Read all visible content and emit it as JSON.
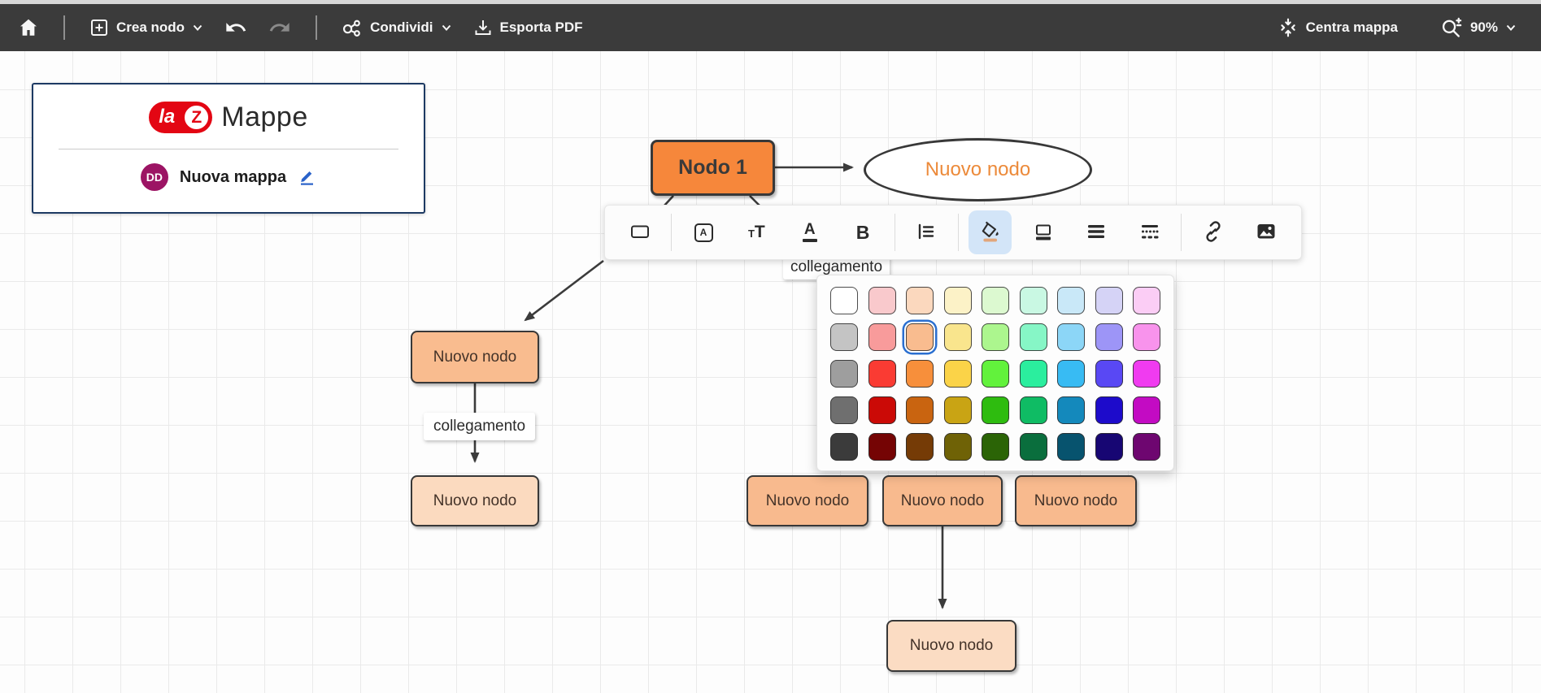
{
  "topbar": {
    "buttons": {
      "crea_nodo": "Crea nodo",
      "condividi": "Condividi",
      "esporta_pdf": "Esporta PDF",
      "centra_mappa": "Centra mappa"
    },
    "zoom_level": "90%"
  },
  "map_card": {
    "logo": {
      "la": "la",
      "z": "Z",
      "name": "Mappe"
    },
    "owner_initials": "DD",
    "title": "Nuova mappa"
  },
  "canvas": {
    "nodes": [
      {
        "id": "root",
        "label": "Nodo 1",
        "fill": "#F6873B"
      },
      {
        "id": "ellipse",
        "label": "Nuovo nodo",
        "fill": "#FFFFFF"
      },
      {
        "id": "left-top",
        "label": "Nuovo nodo",
        "fill": "#F9BC8F"
      },
      {
        "id": "left-bottom",
        "label": "Nuovo nodo",
        "fill": "#FBDABF"
      },
      {
        "id": "mid-a",
        "label": "Nuovo nodo",
        "fill": "#F8BA8E"
      },
      {
        "id": "mid-b",
        "label": "Nuovo nodo",
        "fill": "#F8BA8E"
      },
      {
        "id": "mid-c",
        "label": "Nuovo nodo",
        "fill": "#F8BA8E"
      },
      {
        "id": "bottom",
        "label": "Nuovo nodo",
        "fill": "#FBDCC3"
      }
    ],
    "edge_label": "collegamento",
    "edge_label_partial": "collegamento"
  },
  "format_toolbar": {
    "tools": [
      "shape",
      "text-background",
      "font-size",
      "text-color",
      "bold",
      "align",
      "fill-color",
      "border-color",
      "border-width",
      "border-style",
      "link",
      "image"
    ],
    "active_tool": "fill-color"
  },
  "palette": {
    "selected": {
      "row": 1,
      "col": 2
    },
    "rows": [
      [
        "#FFFFFF",
        "#F9C9CC",
        "#FBD8BE",
        "#FCF2C7",
        "#DCF9D0",
        "#C9F8E3",
        "#C9E8F8",
        "#D5D3F6",
        "#FBCDF5"
      ],
      [
        "#C4C4C4",
        "#F89B9B",
        "#F9BC8F",
        "#F9E58D",
        "#ACF68E",
        "#86F6C6",
        "#8CD6F7",
        "#9D95F7",
        "#F893EC"
      ],
      [
        "#9E9E9E",
        "#FA3B33",
        "#F78F3B",
        "#FBD348",
        "#62F23C",
        "#2BEE9E",
        "#38BBF3",
        "#5948F4",
        "#F03BF0"
      ],
      [
        "#6F6F6F",
        "#CB0A06",
        "#C96410",
        "#C9A414",
        "#2EBC0F",
        "#0FBC64",
        "#1489BC",
        "#1D0BCB",
        "#C30BC3"
      ],
      [
        "#3B3B3B",
        "#750404",
        "#753B06",
        "#6F6206",
        "#2B6406",
        "#0A6E3D",
        "#07536E",
        "#170673",
        "#6E0670"
      ]
    ]
  },
  "colors": {
    "topbar_bg": "#3b3b3b",
    "accent_blue": "#2a6fd0",
    "logo_red": "#E30613",
    "avatar_purple": "#9C1464",
    "edge_color": "#3b3b3b"
  }
}
